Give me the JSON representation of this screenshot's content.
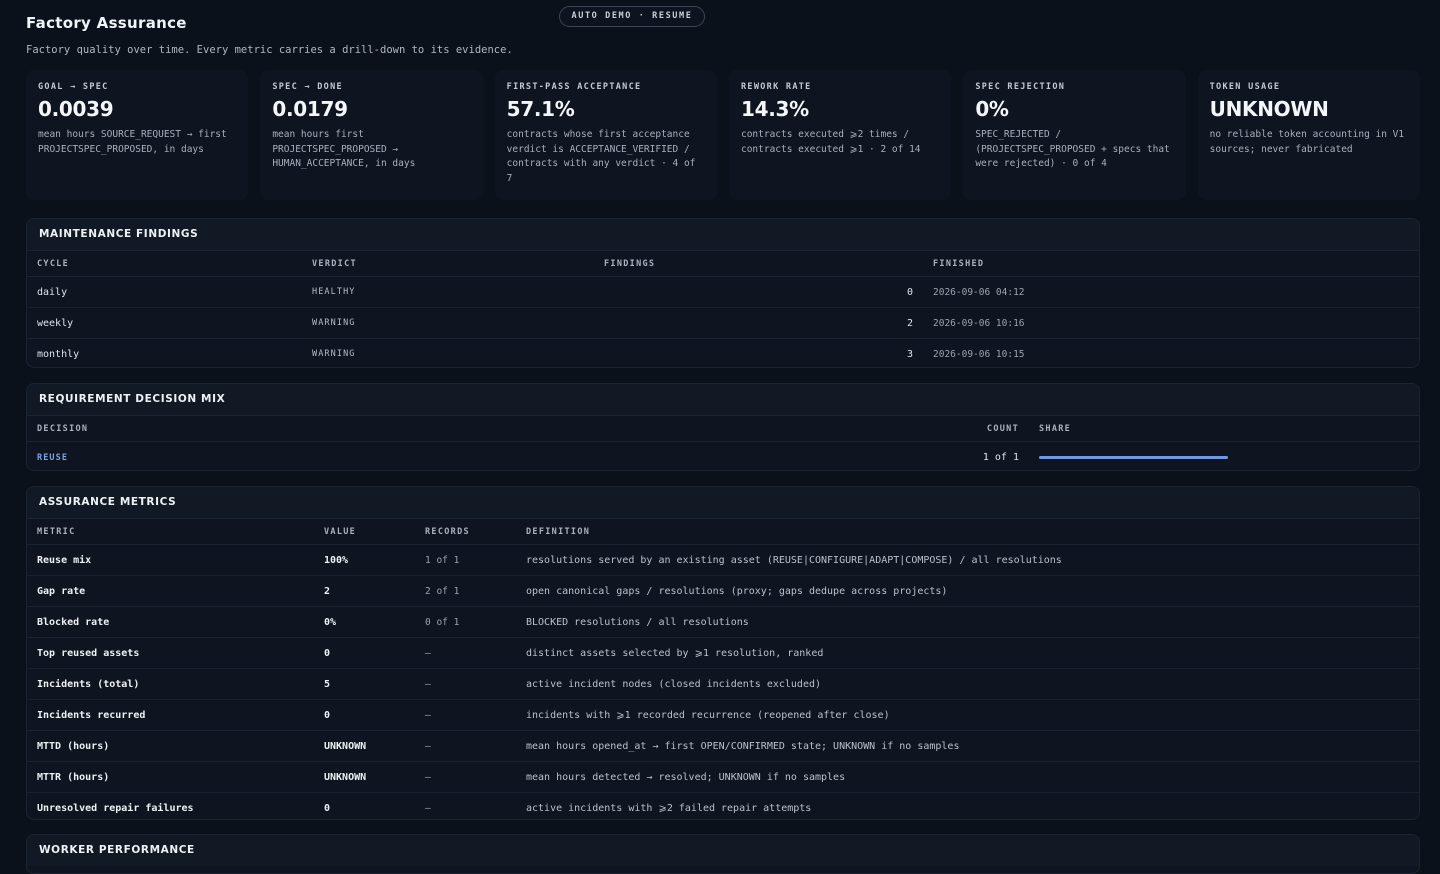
{
  "header": {
    "title": "Factory Assurance",
    "subtitle": "Factory quality over time. Every metric carries a drill-down to its evidence.",
    "demo_button": "AUTO DEMO · RESUME"
  },
  "kpis": [
    {
      "label": "GOAL → SPEC",
      "value": "0.0039",
      "desc": "mean hours SOURCE_REQUEST → first PROJECTSPEC_PROPOSED, in days"
    },
    {
      "label": "SPEC → DONE",
      "value": "0.0179",
      "desc": "mean hours first PROJECTSPEC_PROPOSED → HUMAN_ACCEPTANCE, in days"
    },
    {
      "label": "FIRST-PASS ACCEPTANCE",
      "value": "57.1%",
      "desc": "contracts whose first acceptance verdict is ACCEPTANCE_VERIFIED / contracts with any verdict · 4 of 7"
    },
    {
      "label": "REWORK RATE",
      "value": "14.3%",
      "desc": "contracts executed ⩾2 times / contracts executed ⩾1 · 2 of 14"
    },
    {
      "label": "SPEC REJECTION",
      "value": "0%",
      "desc": "SPEC_REJECTED / (PROJECTSPEC_PROPOSED + specs that were rejected) · 0 of 4"
    },
    {
      "label": "TOKEN USAGE",
      "value": "UNKNOWN",
      "desc": "no reliable token accounting in V1 sources; never fabricated"
    }
  ],
  "maintenance": {
    "title": "MAINTENANCE FINDINGS",
    "columns": {
      "cycle": "CYCLE",
      "verdict": "VERDICT",
      "findings": "FINDINGS",
      "finished": "FINISHED"
    },
    "rows": [
      {
        "cycle": "daily",
        "verdict": "HEALTHY",
        "findings": "0",
        "finished": "2026-09-06 04:12"
      },
      {
        "cycle": "weekly",
        "verdict": "WARNING",
        "findings": "2",
        "finished": "2026-09-06 10:16"
      },
      {
        "cycle": "monthly",
        "verdict": "WARNING",
        "findings": "3",
        "finished": "2026-09-06 10:15"
      }
    ]
  },
  "decision_mix": {
    "title": "REQUIREMENT DECISION MIX",
    "columns": {
      "decision": "DECISION",
      "count": "COUNT",
      "share": "SHARE"
    },
    "rows": [
      {
        "decision": "REUSE",
        "count": "1 of 1",
        "share": 1.0
      }
    ],
    "bar_color": "#6f9ae3"
  },
  "assurance": {
    "title": "ASSURANCE METRICS",
    "columns": {
      "metric": "METRIC",
      "value": "VALUE",
      "records": "RECORDS",
      "definition": "DEFINITION"
    },
    "rows": [
      {
        "metric": "Reuse mix",
        "value": "100%",
        "records": "1 of 1",
        "definition": "resolutions served by an existing asset (REUSE|CONFIGURE|ADAPT|COMPOSE) / all resolutions"
      },
      {
        "metric": "Gap rate",
        "value": "2",
        "records": "2 of 1",
        "definition": "open canonical gaps / resolutions (proxy; gaps dedupe across projects)"
      },
      {
        "metric": "Blocked rate",
        "value": "0%",
        "records": "0 of 1",
        "definition": "BLOCKED resolutions / all resolutions"
      },
      {
        "metric": "Top reused assets",
        "value": "0",
        "records": "—",
        "definition": "distinct assets selected by ⩾1 resolution, ranked"
      },
      {
        "metric": "Incidents (total)",
        "value": "5",
        "records": "—",
        "definition": "active incident nodes (closed incidents excluded)"
      },
      {
        "metric": "Incidents recurred",
        "value": "0",
        "records": "—",
        "definition": "incidents with ⩾1 recorded recurrence (reopened after close)"
      },
      {
        "metric": "MTTD (hours)",
        "value": "UNKNOWN",
        "records": "—",
        "definition": "mean hours opened_at → first OPEN/CONFIRMED state; UNKNOWN if no samples"
      },
      {
        "metric": "MTTR (hours)",
        "value": "UNKNOWN",
        "records": "—",
        "definition": "mean hours detected → resolved; UNKNOWN if no samples"
      },
      {
        "metric": "Unresolved repair failures",
        "value": "0",
        "records": "—",
        "definition": "active incidents with ⩾2 failed repair attempts"
      }
    ]
  },
  "worker": {
    "title": "WORKER PERFORMANCE"
  }
}
